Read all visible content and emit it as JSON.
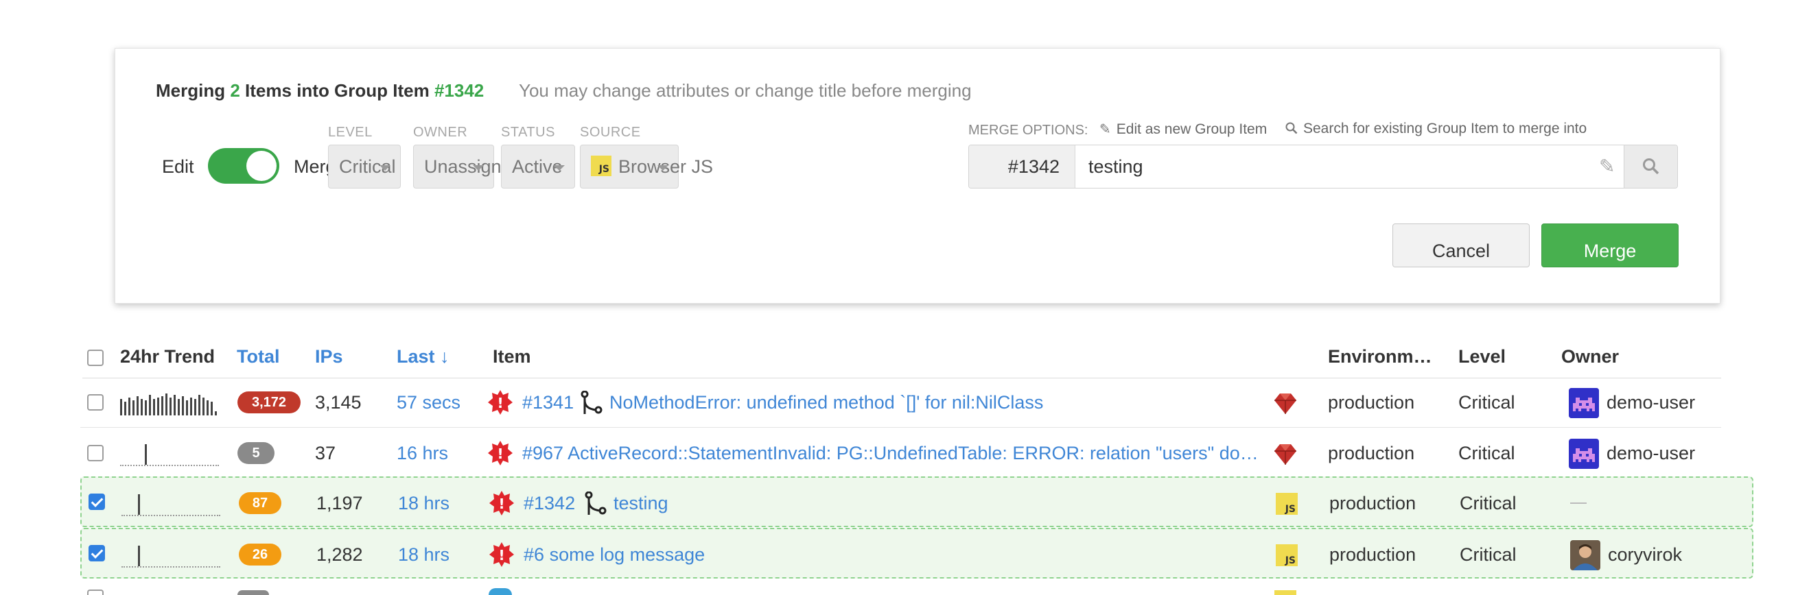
{
  "modal": {
    "title_pre": "Merging",
    "title_count": "2",
    "title_mid": "Items into Group Item",
    "title_id": "#1342",
    "hint": "You may change attributes or change title before merging",
    "edit_label": "Edit",
    "merge_label": "Merge",
    "toggle_state": "on",
    "fields": {
      "level": {
        "label": "LEVEL",
        "value": "Critical"
      },
      "owner": {
        "label": "OWNER",
        "value": "Unassigned"
      },
      "status": {
        "label": "STATUS",
        "value": "Active"
      },
      "source": {
        "label": "SOURCE",
        "value": "Browser JS",
        "icon": "javascript-icon"
      }
    },
    "merge_options": {
      "label": "MERGE OPTIONS:",
      "edit_new": "Edit as new Group Item",
      "search_existing": "Search for existing Group Item to merge into"
    },
    "group_id": "#1342",
    "group_title": "testing",
    "cancel_label": "Cancel",
    "merge_button_label": "Merge"
  },
  "table": {
    "headers": {
      "trend": "24hr Trend",
      "total": "Total",
      "ips": "IPs",
      "last": "Last",
      "item": "Item",
      "environment": "Environm…",
      "level": "Level",
      "owner": "Owner"
    },
    "sort_indicator": "↓",
    "rows": [
      {
        "checked": false,
        "total": "3,172",
        "badge_color": "#c0392b",
        "ips": "3,145",
        "last": "57 secs",
        "item_id": "#1341",
        "forked": true,
        "title": "NoMethodError: undefined method `[]' for nil:NilClass",
        "framework": "ruby-icon",
        "environment": "production",
        "level": "Critical",
        "owner": "demo-user",
        "owner_avatar": "space-invader-avatar"
      },
      {
        "checked": false,
        "total": "5",
        "badge_color": "#8a8a8a",
        "ips": "37",
        "last": "16 hrs",
        "item_id": "#967",
        "forked": false,
        "title": "ActiveRecord::StatementInvalid: PG::UndefinedTable: ERROR: relation \"users\" do…",
        "framework": "ruby-icon",
        "environment": "production",
        "level": "Critical",
        "owner": "demo-user",
        "owner_avatar": "space-invader-avatar"
      },
      {
        "checked": true,
        "total": "87",
        "badge_color": "#f39c12",
        "ips": "1,197",
        "last": "18 hrs",
        "item_id": "#1342",
        "forked": true,
        "title": "testing",
        "framework": "javascript-icon",
        "environment": "production",
        "level": "Critical",
        "owner": "—",
        "owner_avatar": ""
      },
      {
        "checked": true,
        "total": "26",
        "badge_color": "#f39c12",
        "ips": "1,282",
        "last": "18 hrs",
        "item_id": "#6",
        "forked": false,
        "title": "some log message",
        "framework": "javascript-icon",
        "environment": "production",
        "level": "Critical",
        "owner": "coryvirok",
        "owner_avatar": "photo-avatar"
      }
    ]
  }
}
